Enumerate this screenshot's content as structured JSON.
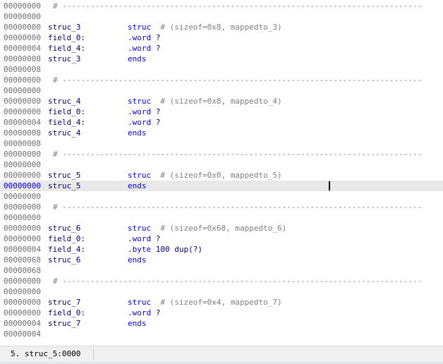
{
  "editor": {
    "lines": [
      {
        "addr": "00000000",
        "type": "comment",
        "text": "# -----------------------------------------------------------------------------"
      },
      {
        "addr": "00000000",
        "type": "blank"
      },
      {
        "addr": "00000000",
        "type": "code",
        "name": "struc_3",
        "kw": "struc",
        "arg": "",
        "comment": "# (sizeof=0x8, mappedto_3)"
      },
      {
        "addr": "00000000",
        "type": "code",
        "name": "field_0:",
        "kw": ".word",
        "arg": "?",
        "comment": ""
      },
      {
        "addr": "00000004",
        "type": "code",
        "name": "field_4:",
        "kw": ".word",
        "arg": "?",
        "comment": ""
      },
      {
        "addr": "00000008",
        "type": "code",
        "name": "struc_3",
        "kw": "ends",
        "arg": "",
        "comment": ""
      },
      {
        "addr": "00000008",
        "type": "blank"
      },
      {
        "addr": "00000000",
        "type": "comment",
        "text": "# -----------------------------------------------------------------------------"
      },
      {
        "addr": "00000000",
        "type": "blank"
      },
      {
        "addr": "00000000",
        "type": "code",
        "name": "struc_4",
        "kw": "struc",
        "arg": "",
        "comment": "# (sizeof=0x8, mappedto_4)"
      },
      {
        "addr": "00000000",
        "type": "code",
        "name": "field_0:",
        "kw": ".word",
        "arg": "?",
        "comment": ""
      },
      {
        "addr": "00000004",
        "type": "code",
        "name": "field_4:",
        "kw": ".word",
        "arg": "?",
        "comment": ""
      },
      {
        "addr": "00000008",
        "type": "code",
        "name": "struc_4",
        "kw": "ends",
        "arg": "",
        "comment": ""
      },
      {
        "addr": "00000008",
        "type": "blank"
      },
      {
        "addr": "00000000",
        "type": "comment",
        "text": "# -----------------------------------------------------------------------------"
      },
      {
        "addr": "00000000",
        "type": "blank"
      },
      {
        "addr": "00000000",
        "type": "code",
        "name": "struc_5",
        "kw": "struc",
        "arg": "",
        "comment": "# (sizeof=0x0, mappedto_5)"
      },
      {
        "addr": "00000000",
        "type": "code",
        "name": "struc_5",
        "kw": "ends",
        "arg": "",
        "comment": "",
        "current": true
      },
      {
        "addr": "00000000",
        "type": "blank"
      },
      {
        "addr": "00000000",
        "type": "comment",
        "text": "# -----------------------------------------------------------------------------"
      },
      {
        "addr": "00000000",
        "type": "blank"
      },
      {
        "addr": "00000000",
        "type": "code",
        "name": "struc_6",
        "kw": "struc",
        "arg": "",
        "comment": "# (sizeof=0x68, mappedto_6)"
      },
      {
        "addr": "00000000",
        "type": "code",
        "name": "field_0:",
        "kw": ".word",
        "arg": "?",
        "comment": ""
      },
      {
        "addr": "00000004",
        "type": "code",
        "name": "field_4:",
        "kw": ".byte",
        "arg": "100 dup(?)",
        "comment": ""
      },
      {
        "addr": "00000068",
        "type": "code",
        "name": "struc_6",
        "kw": "ends",
        "arg": "",
        "comment": ""
      },
      {
        "addr": "00000068",
        "type": "blank"
      },
      {
        "addr": "00000000",
        "type": "comment",
        "text": "# -----------------------------------------------------------------------------"
      },
      {
        "addr": "00000000",
        "type": "blank"
      },
      {
        "addr": "00000000",
        "type": "code",
        "name": "struc_7",
        "kw": "struc",
        "arg": "",
        "comment": "# (sizeof=0x4, mappedto_7)"
      },
      {
        "addr": "00000000",
        "type": "code",
        "name": "field_0:",
        "kw": ".word",
        "arg": "?",
        "comment": ""
      },
      {
        "addr": "00000004",
        "type": "code",
        "name": "struc_7",
        "kw": "ends",
        "arg": "",
        "comment": ""
      },
      {
        "addr": "00000004",
        "type": "blank"
      }
    ]
  },
  "statusbar": {
    "text": "5. struc_5:0000"
  }
}
